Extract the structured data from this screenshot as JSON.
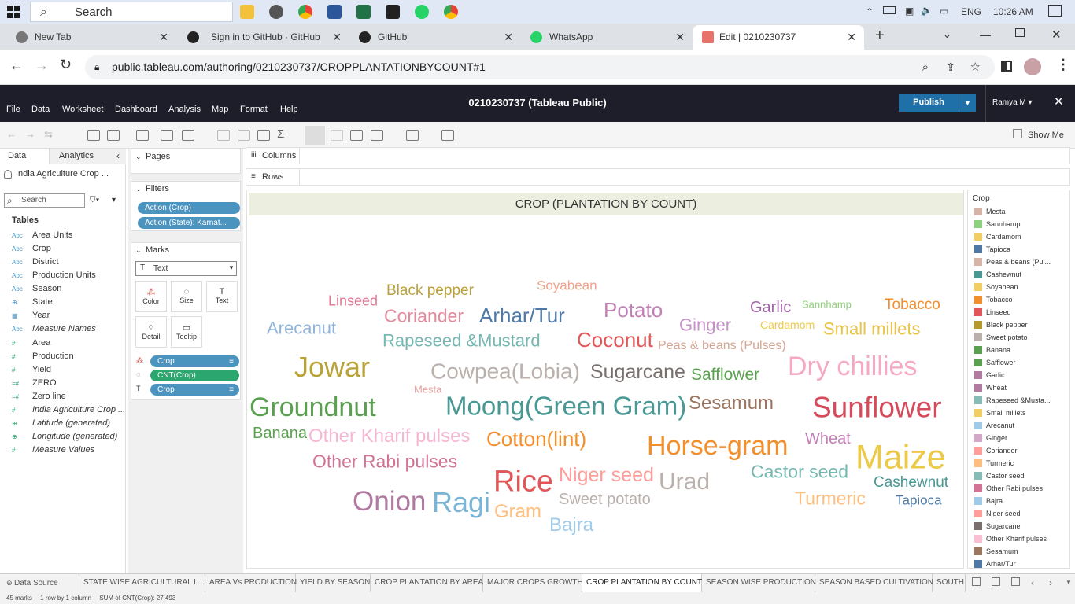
{
  "taskbar": {
    "search_placeholder": "Search",
    "lang": "ENG",
    "time": "10:26 AM"
  },
  "browser_tabs": [
    {
      "label": "New Tab"
    },
    {
      "label": "Sign in to GitHub · GitHub"
    },
    {
      "label": "GitHub"
    },
    {
      "label": "WhatsApp"
    },
    {
      "label": "Edit | 0210230737",
      "active": true
    }
  ],
  "address": {
    "url": "public.tableau.com/authoring/0210230737/CROPPLANTATIONBYCOUNT#1"
  },
  "tableau": {
    "menu": [
      "File",
      "Data",
      "Worksheet",
      "Dashboard",
      "Analysis",
      "Map",
      "Format",
      "Help"
    ],
    "title": "0210230737 (Tableau Public)",
    "publish_label": "Publish",
    "user": "Ramya M ▾",
    "show_me": "Show Me"
  },
  "data_pane": {
    "tab_data": "Data",
    "tab_analytics": "Analytics",
    "datasource": "India Agriculture Crop ...",
    "search_placeholder": "Search",
    "tables_label": "Tables",
    "fields": [
      {
        "type": "Abc",
        "name": "Area Units"
      },
      {
        "type": "Abc",
        "name": "Crop"
      },
      {
        "type": "Abc",
        "name": "District"
      },
      {
        "type": "Abc",
        "name": "Production Units"
      },
      {
        "type": "Abc",
        "name": "Season"
      },
      {
        "type": "⊕",
        "name": "State"
      },
      {
        "type": "▦",
        "name": "Year"
      },
      {
        "type": "Abc",
        "name": "Measure Names",
        "italic": true
      },
      {
        "type": "#",
        "name": "Area"
      },
      {
        "type": "#",
        "name": "Production"
      },
      {
        "type": "#",
        "name": "Yield"
      },
      {
        "type": "=#",
        "name": "ZERO"
      },
      {
        "type": "=#",
        "name": "Zero line"
      },
      {
        "type": "#",
        "name": "India Agriculture Crop ...",
        "italic": true
      },
      {
        "type": "⊕",
        "name": "Latitude (generated)",
        "italic": true
      },
      {
        "type": "⊕",
        "name": "Longitude (generated)",
        "italic": true
      },
      {
        "type": "#",
        "name": "Measure Values",
        "italic": true
      }
    ]
  },
  "shelves": {
    "pages": "Pages",
    "filters": "Filters",
    "filter_pills": [
      "Action (Crop)",
      "Action (State): Karnat..."
    ],
    "marks": "Marks",
    "mark_type": "Text",
    "mark_buttons": [
      "Color",
      "Size",
      "Text",
      "Detail",
      "Tooltip"
    ],
    "mark_pills": [
      "Crop",
      "CNT(Crop)",
      "Crop"
    ],
    "columns": "Columns",
    "rows": "Rows"
  },
  "colors": {
    "publish": "#1f6fa8",
    "pill_blue": "#4c94c0",
    "pill_green": "#2aa66e",
    "header": "#1e1e2b"
  },
  "chart_data": {
    "type": "wordcloud",
    "title": "CROP (PLANTATION BY COUNT)",
    "words": [
      {
        "text": "Black pepper",
        "color": "#b9a03c"
      },
      {
        "text": "Soyabean",
        "color": "#f0a28a"
      },
      {
        "text": "Linseed",
        "color": "#e07a95"
      },
      {
        "text": "Coriander",
        "color": "#e58a9c"
      },
      {
        "text": "Arhar/Tur",
        "color": "#4e79a7"
      },
      {
        "text": "Potato",
        "color": "#c37fb6"
      },
      {
        "text": "Garlic",
        "color": "#a266a8"
      },
      {
        "text": "Sannhamp",
        "color": "#8fcf7a"
      },
      {
        "text": "Tobacco",
        "color": "#f28e2b"
      },
      {
        "text": "Ginger",
        "color": "#c792c9"
      },
      {
        "text": "Cardamom",
        "color": "#edc948"
      },
      {
        "text": "Small millets",
        "color": "#e8c547"
      },
      {
        "text": "Arecanut",
        "color": "#8fb4db"
      },
      {
        "text": "Rapeseed &Mustard",
        "color": "#76b7b2"
      },
      {
        "text": "Coconut",
        "color": "#e15759"
      },
      {
        "text": "Peas & beans (Pulses)",
        "color": "#d5a593"
      },
      {
        "text": "Jowar",
        "color": "#b9a237"
      },
      {
        "text": "Cowpea(Lobia)",
        "color": "#bab0ac"
      },
      {
        "text": "Sugarcane",
        "color": "#79706e"
      },
      {
        "text": "Safflower",
        "color": "#59a14f"
      },
      {
        "text": "Dry chillies",
        "color": "#f5a8c4"
      },
      {
        "text": "Groundnut",
        "color": "#59a14f"
      },
      {
        "text": "Mesta",
        "color": "#e8a2a0"
      },
      {
        "text": "Moong(Green Gram)",
        "color": "#499894"
      },
      {
        "text": "Sesamum",
        "color": "#9c755f"
      },
      {
        "text": "Sunflower",
        "color": "#d64b5c"
      },
      {
        "text": "Banana",
        "color": "#59a14f"
      },
      {
        "text": "Other Kharif pulses",
        "color": "#f7b6d2"
      },
      {
        "text": "Cotton(lint)",
        "color": "#f28e2b"
      },
      {
        "text": "Horse-gram",
        "color": "#f28e2b"
      },
      {
        "text": "Wheat",
        "color": "#c37fb6"
      },
      {
        "text": "Maize",
        "color": "#edc948"
      },
      {
        "text": "Other Rabi pulses",
        "color": "#d37295"
      },
      {
        "text": "Rice",
        "color": "#e15759"
      },
      {
        "text": "Niger seed",
        "color": "#ff9d9a"
      },
      {
        "text": "Urad",
        "color": "#bab0ac"
      },
      {
        "text": "Castor seed",
        "color": "#76b7b2"
      },
      {
        "text": "Cashewnut",
        "color": "#499894"
      },
      {
        "text": "Onion",
        "color": "#b07aa1"
      },
      {
        "text": "Ragi",
        "color": "#79b5d6"
      },
      {
        "text": "Gram",
        "color": "#ffbe7d"
      },
      {
        "text": "Sweet potato",
        "color": "#bab0ac"
      },
      {
        "text": "Turmeric",
        "color": "#ffbe7d"
      },
      {
        "text": "Tapioca",
        "color": "#4e79a7"
      },
      {
        "text": "Bajra",
        "color": "#a0cbe8"
      }
    ],
    "legend": {
      "title": "Crop",
      "items": [
        {
          "name": "Mesta",
          "color": "#d5b3a6"
        },
        {
          "name": "Sannhamp",
          "color": "#8cd17d"
        },
        {
          "name": "Cardamom",
          "color": "#f1ce63"
        },
        {
          "name": "Tapioca",
          "color": "#4e79a7"
        },
        {
          "name": "Peas & beans (Pul...",
          "color": "#d7b5a6"
        },
        {
          "name": "Cashewnut",
          "color": "#499894"
        },
        {
          "name": "Soyabean",
          "color": "#f1ce63"
        },
        {
          "name": "Tobacco",
          "color": "#f28e2b"
        },
        {
          "name": "Linseed",
          "color": "#e15759"
        },
        {
          "name": "Black pepper",
          "color": "#b6992d"
        },
        {
          "name": "Sweet potato",
          "color": "#bab0ac"
        },
        {
          "name": "Banana",
          "color": "#59a14f"
        },
        {
          "name": "Safflower",
          "color": "#59a14f"
        },
        {
          "name": "Garlic",
          "color": "#b07aa1"
        },
        {
          "name": "Wheat",
          "color": "#b07aa1"
        },
        {
          "name": "Rapeseed &Musta...",
          "color": "#86bcb6"
        },
        {
          "name": "Small millets",
          "color": "#f1ce63"
        },
        {
          "name": "Arecanut",
          "color": "#a0cbe8"
        },
        {
          "name": "Ginger",
          "color": "#d4a6c8"
        },
        {
          "name": "Coriander",
          "color": "#ff9d9a"
        },
        {
          "name": "Turmeric",
          "color": "#ffbe7d"
        },
        {
          "name": "Castor seed",
          "color": "#86bcb6"
        },
        {
          "name": "Other Rabi pulses",
          "color": "#d37295"
        },
        {
          "name": "Bajra",
          "color": "#a0cbe8"
        },
        {
          "name": "Niger seed",
          "color": "#ff9d9a"
        },
        {
          "name": "Sugarcane",
          "color": "#79706e"
        },
        {
          "name": "Other Kharif pulses",
          "color": "#fabfd2"
        },
        {
          "name": "Sesamum",
          "color": "#9d7660"
        },
        {
          "name": "Arhar/Tur",
          "color": "#4e79a7"
        }
      ]
    }
  },
  "sheet_tabs": [
    "Data Source",
    "STATE WISE AGRICULTURAL L...",
    "AREA Vs PRODUCTION",
    "YIELD BY SEASON",
    "CROP PLANTATION BY AREA",
    "MAJOR CROPS GROWTH",
    "CROP PLANTATION BY COUNT",
    "SEASON WISE PRODUCTION",
    "SEASON BASED CULTIVATION",
    "SOUTH"
  ],
  "active_sheet": "CROP PLANTATION BY COUNT",
  "status": {
    "marks": "45 marks",
    "layout": "1 row by 1 column",
    "sum": "SUM of CNT(Crop): 27,493"
  }
}
